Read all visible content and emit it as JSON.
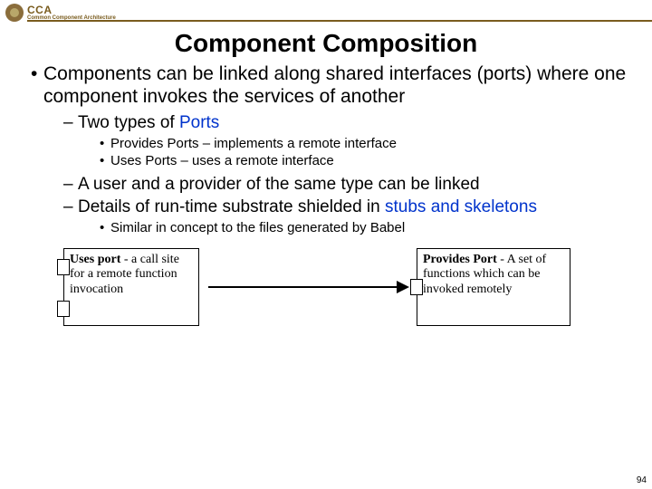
{
  "header": {
    "logo_title": "CCA",
    "logo_sub": "Common Component Architecture"
  },
  "title": "Component Composition",
  "bullets": {
    "b1": "Components can be linked along shared interfaces (ports) where one component invokes the services of another",
    "s1_prefix": "Two types of ",
    "s1_link": "Ports",
    "ss1": "Provides Ports – implements a remote interface",
    "ss2": "Uses Ports – uses a remote interface",
    "s2": "A user and a provider of the same type can be linked",
    "s3_prefix": "Details of run-time substrate shielded in ",
    "s3_link": "stubs and skeletons",
    "ss3": "Similar in concept to the files generated by Babel"
  },
  "diagram": {
    "left_title": "Uses port",
    "left_rest": " - a call site for a remote function invocation",
    "right_title": "Provides Port",
    "right_rest": " - A set of functions which can be invoked remotely"
  },
  "page_number": "94"
}
